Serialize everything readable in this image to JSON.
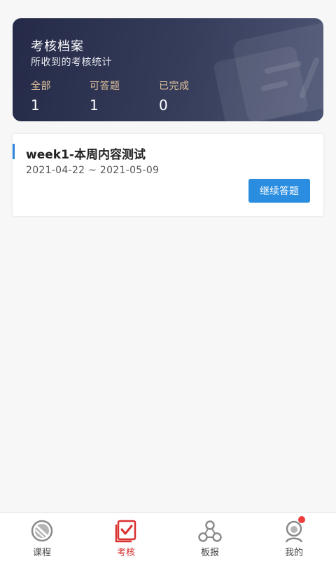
{
  "stats": {
    "title": "考核档案",
    "subtitle": "所收到的考核统计",
    "items": [
      {
        "label": "全部",
        "value": "1"
      },
      {
        "label": "可答题",
        "value": "1"
      },
      {
        "label": "已完成",
        "value": "0"
      }
    ]
  },
  "exams": [
    {
      "title": "week1-本周内容测试",
      "dates": "2021-04-22 ~ 2021-05-09",
      "button_label": "继续答题"
    }
  ],
  "nav": {
    "items": [
      {
        "label": "课程",
        "icon": "course-icon"
      },
      {
        "label": "考核",
        "icon": "exam-icon",
        "active": true
      },
      {
        "label": "板报",
        "icon": "share-icon"
      },
      {
        "label": "我的",
        "icon": "profile-icon",
        "badge": true
      }
    ]
  },
  "colors": {
    "accent": "#2a8de0",
    "active_tab": "#d9312f",
    "card_bg": "#2b3150",
    "stat_label": "#e4c59e",
    "badge": "#ee3b3b"
  }
}
